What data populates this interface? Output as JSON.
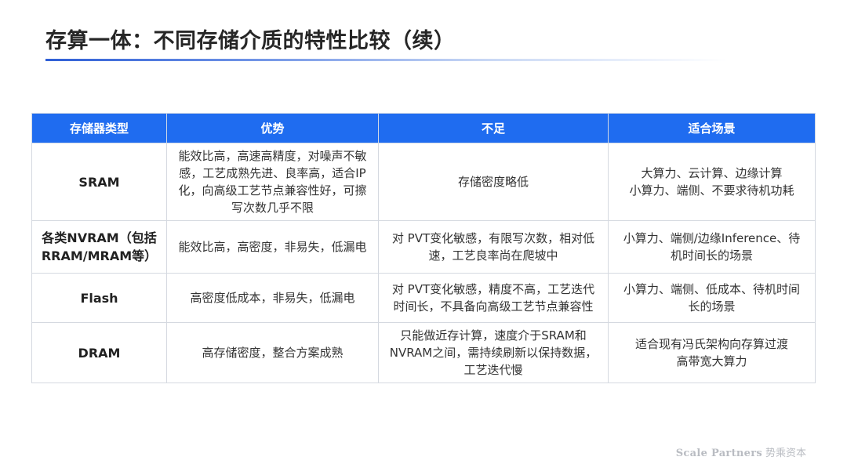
{
  "slide": {
    "title": "存算一体：不同存储介质的特性比较（续）"
  },
  "table": {
    "headers": [
      "存储器类型",
      "优势",
      "不足",
      "适合场景"
    ],
    "rows": [
      {
        "type": [
          "SRAM"
        ],
        "advantage": [
          "能效比高，高速高精度，对噪声不敏",
          "感，工艺成熟先进、良率高，适合IP",
          "化，向高级工艺节点兼容性好，可擦",
          "写次数几乎不限"
        ],
        "shortcoming": [
          "存储密度略低"
        ],
        "scenario": [
          "大算力、云计算、边缘计算",
          "小算力、端侧、不要求待机功耗"
        ]
      },
      {
        "type": [
          "各类NVRAM（包括",
          "RRAM/MRAM等）"
        ],
        "advantage": [
          "能效比高，高密度，非易失，低漏电"
        ],
        "shortcoming": [
          "对 PVT变化敏感，有限写次数，相对低",
          "速，工艺良率尚在爬坡中"
        ],
        "scenario": [
          "小算力、端侧/边缘Inference、待",
          "机时间长的场景"
        ]
      },
      {
        "type": [
          "Flash"
        ],
        "advantage": [
          "高密度低成本，非易失，低漏电"
        ],
        "shortcoming": [
          "对 PVT变化敏感，精度不高，工艺迭代",
          "时间长，不具备向高级工艺节点兼容性"
        ],
        "scenario": [
          "小算力、端侧、低成本、待机时间",
          "长的场景"
        ]
      },
      {
        "type": [
          "DRAM"
        ],
        "advantage": [
          "高存储密度，整合方案成熟"
        ],
        "shortcoming": [
          "只能做近存计算，速度介于SRAM和",
          "NVRAM之间，需持续刷新以保持数据，",
          "工艺迭代慢"
        ],
        "scenario": [
          "适合现有冯氏架构向存算过渡",
          "高带宽大算力"
        ]
      }
    ]
  },
  "footer": {
    "brand_en": "Scale Partners",
    "brand_cn": "势乘资本"
  }
}
